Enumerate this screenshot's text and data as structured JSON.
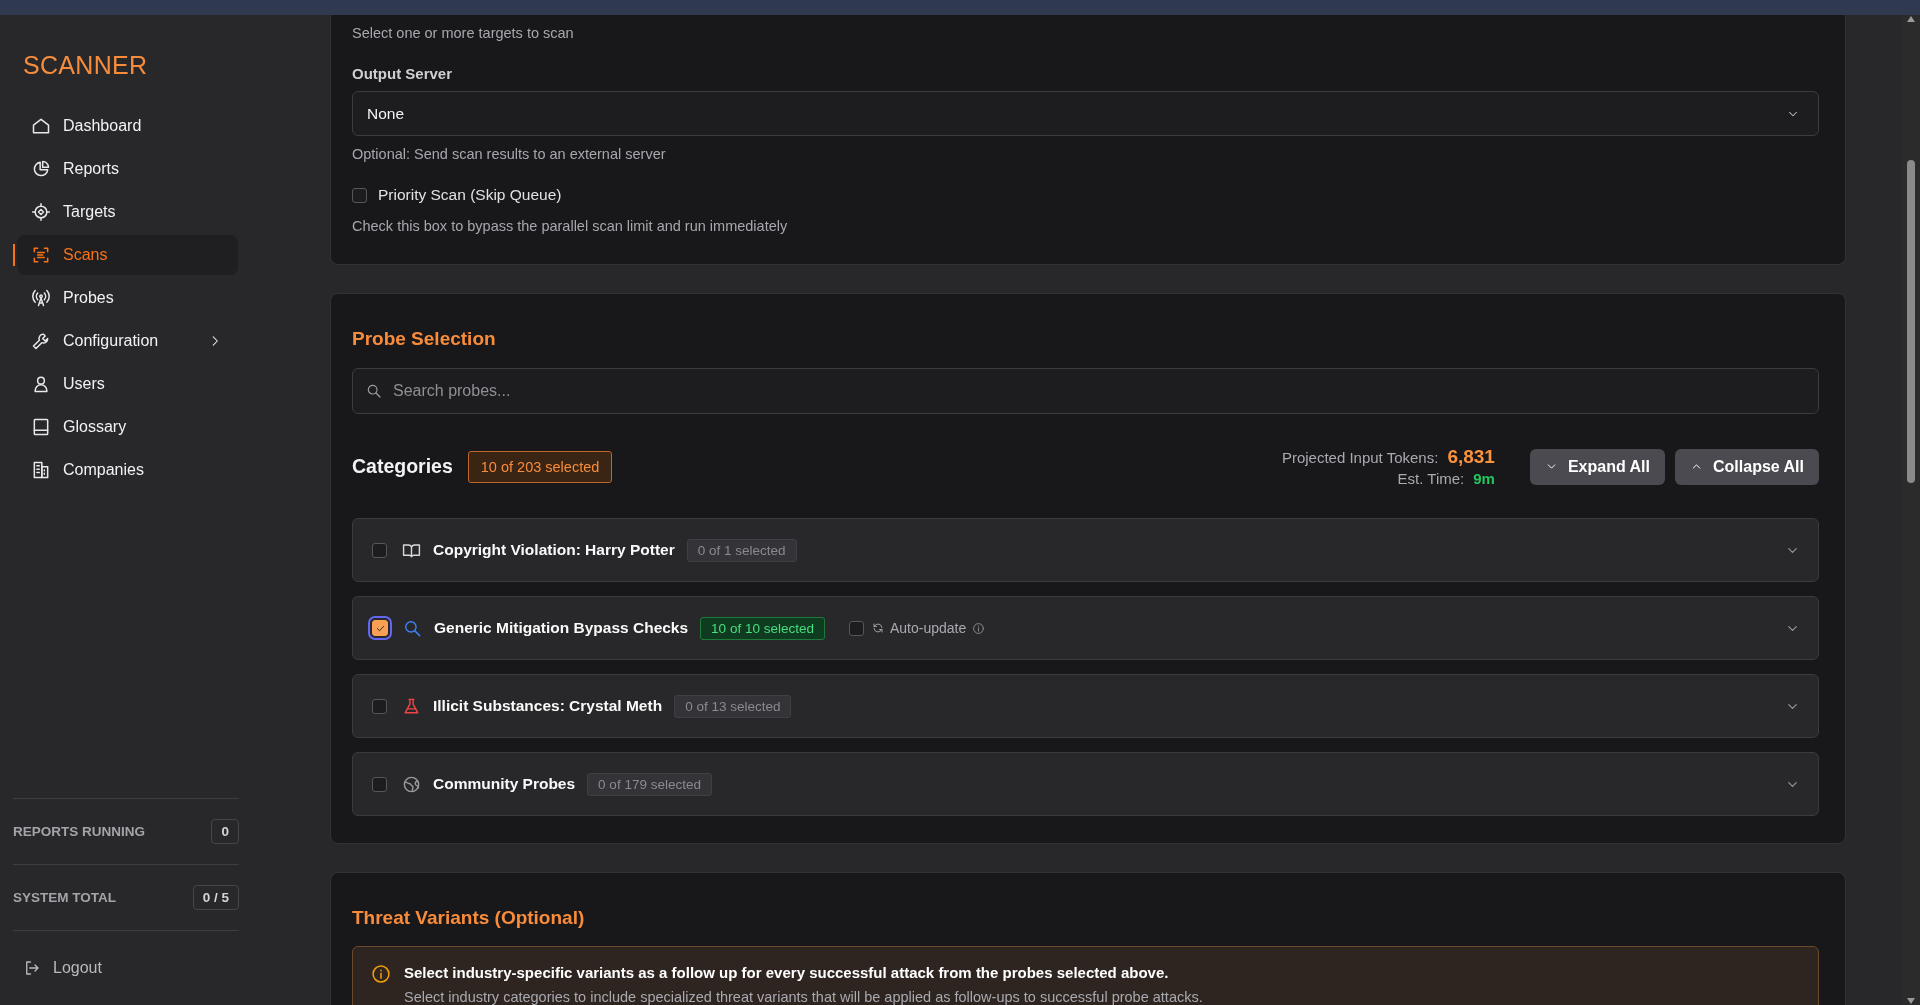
{
  "sidebar": {
    "logo": "SCANNER",
    "items": [
      {
        "label": "Dashboard",
        "kind": "home",
        "selected": false
      },
      {
        "label": "Reports",
        "kind": "pie",
        "selected": false
      },
      {
        "label": "Targets",
        "kind": "target",
        "selected": false
      },
      {
        "label": "Scans",
        "kind": "scan",
        "selected": true
      },
      {
        "label": "Probes",
        "kind": "antenna",
        "selected": false
      },
      {
        "label": "Configuration",
        "kind": "wrench",
        "selected": false,
        "submenu": true
      },
      {
        "label": "Users",
        "kind": "user",
        "selected": false
      },
      {
        "label": "Glossary",
        "kind": "book",
        "selected": false
      },
      {
        "label": "Companies",
        "kind": "building",
        "selected": false
      }
    ],
    "stats": [
      {
        "label": "REPORTS RUNNING",
        "value": "0"
      },
      {
        "label": "SYSTEM TOTAL",
        "value": "0 / 5"
      }
    ],
    "logout": "Logout"
  },
  "scan_settings": {
    "targets_hint": "Select one or more targets to scan",
    "output_server": {
      "label": "Output Server",
      "value": "None",
      "hint": "Optional: Send scan results to an external server"
    },
    "priority_scan": {
      "label": "Priority Scan (Skip Queue)",
      "checked": false,
      "hint": "Check this box to bypass the parallel scan limit and run immediately"
    }
  },
  "probe_selection": {
    "title": "Probe Selection",
    "search": {
      "placeholder": "Search probes..."
    },
    "categories_label": "Categories",
    "selected_count": "10 of 203 selected",
    "tokens_label": "Projected Input Tokens:",
    "tokens_value": "6,831",
    "time_label": "Est. Time:",
    "time_value": "9m",
    "buttons": [
      {
        "label": "Expand All",
        "kind": "expand"
      },
      {
        "label": "Collapse All",
        "kind": "collapse"
      }
    ],
    "categories": [
      {
        "name": "Copyright Violation: Harry Potter",
        "kind": "book",
        "checked": false,
        "count": "0 of 1 selected"
      },
      {
        "name": "Generic Mitigation Bypass Checks",
        "kind": "search",
        "checked": true,
        "count": "10 of 10 selected",
        "auto_update": {
          "label": "Auto-update",
          "checked": false
        }
      },
      {
        "name": "Illicit Substances: Crystal Meth",
        "kind": "flask",
        "checked": false,
        "count": "0 of 13 selected"
      },
      {
        "name": "Community Probes",
        "kind": "globe",
        "checked": false,
        "count": "0 of 179 selected"
      }
    ]
  },
  "threat_variants": {
    "title": "Threat Variants (Optional)",
    "notice": {
      "heading": "Select industry-specific variants as a follow up for every successful attack from the probes selected above.",
      "text": "Select industry categories to include specialized threat variants that will be applied as follow-ups to successful probe attacks."
    }
  }
}
